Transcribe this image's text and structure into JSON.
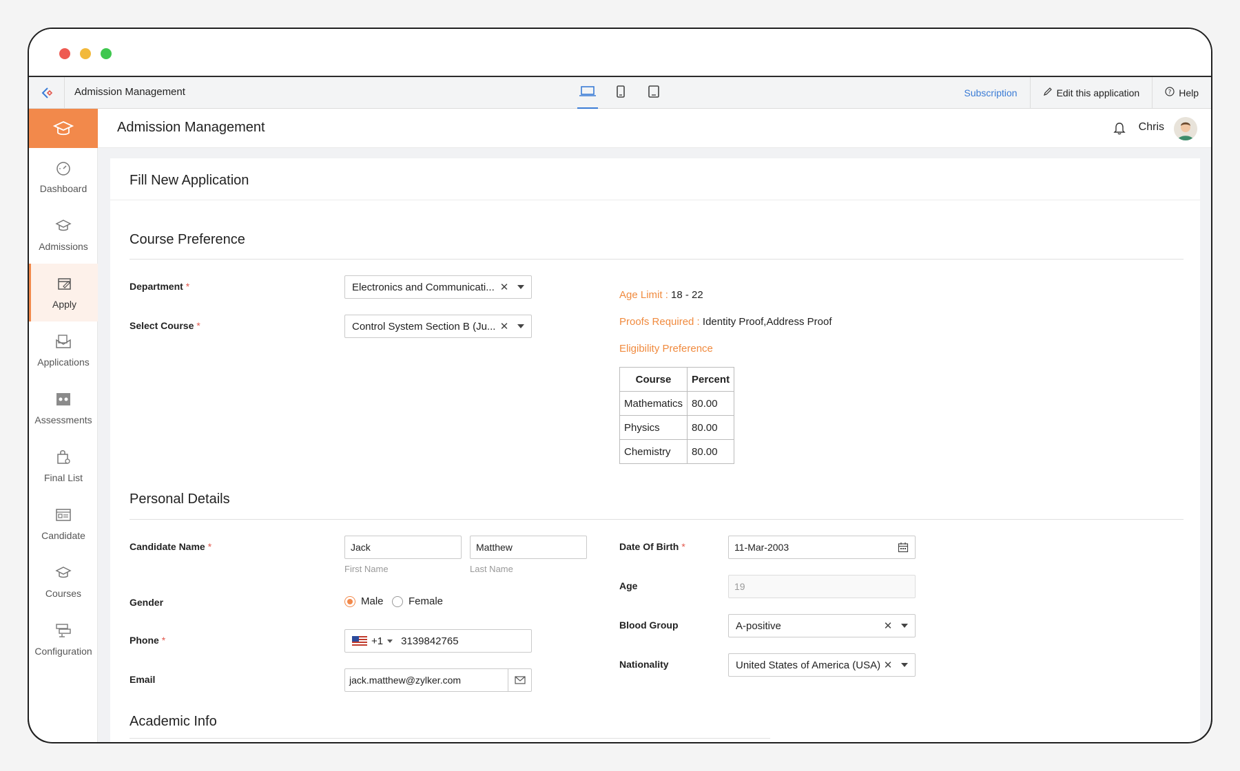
{
  "topbar": {
    "app_title": "Admission Management",
    "subscription": "Subscription",
    "edit_app": "Edit this application",
    "help": "Help"
  },
  "header": {
    "title": "Admission Management",
    "user_name": "Chris"
  },
  "sidebar": {
    "items": [
      {
        "label": "Dashboard",
        "icon": "dashboard-icon"
      },
      {
        "label": "Admissions",
        "icon": "graduation-cap-icon"
      },
      {
        "label": "Apply",
        "icon": "apply-form-icon"
      },
      {
        "label": "Applications",
        "icon": "envelope-icon"
      },
      {
        "label": "Assessments",
        "icon": "assessment-icon"
      },
      {
        "label": "Final List",
        "icon": "bag-icon"
      },
      {
        "label": "Candidate",
        "icon": "id-card-icon"
      },
      {
        "label": "Courses",
        "icon": "graduation-cap-icon"
      },
      {
        "label": "Configuration",
        "icon": "config-icon"
      }
    ],
    "active": "Apply"
  },
  "form": {
    "title": "Fill New Application",
    "course_section": "Course Preference",
    "department_label": "Department",
    "department_value": "Electronics and Communicati...",
    "course_label": "Select Course",
    "course_value": "Control System Section B (Ju...",
    "age_limit_label": "Age Limit :",
    "age_limit_value": "18 - 22",
    "proofs_label": "Proofs Required :",
    "proofs_value": "Identity Proof,Address Proof",
    "eligibility_label": "Eligibility Preference",
    "eligibility_table": {
      "headers": [
        "Course",
        "Percent"
      ],
      "rows": [
        [
          "Mathematics",
          "80.00"
        ],
        [
          "Physics",
          "80.00"
        ],
        [
          "Chemistry",
          "80.00"
        ]
      ]
    },
    "personal_section": "Personal Details",
    "name_label": "Candidate Name",
    "first_name": "Jack",
    "last_name": "Matthew",
    "first_name_hint": "First Name",
    "last_name_hint": "Last Name",
    "gender_label": "Gender",
    "gender_male": "Male",
    "gender_female": "Female",
    "gender_selected": "Male",
    "phone_label": "Phone",
    "phone_code": "+1",
    "phone_number": "3139842765",
    "email_label": "Email",
    "email_value": "jack.matthew@zylker.com",
    "dob_label": "Date Of Birth",
    "dob_value": "11-Mar-2003",
    "age_label": "Age",
    "age_value": "19",
    "blood_label": "Blood Group",
    "blood_value": "A-positive",
    "nationality_label": "Nationality",
    "nationality_value": "United States of America (USA)",
    "academic_section": "Academic Info"
  },
  "colors": {
    "accent": "#f2894b",
    "link": "#3a7bd5",
    "info_label": "#f08a3e"
  }
}
